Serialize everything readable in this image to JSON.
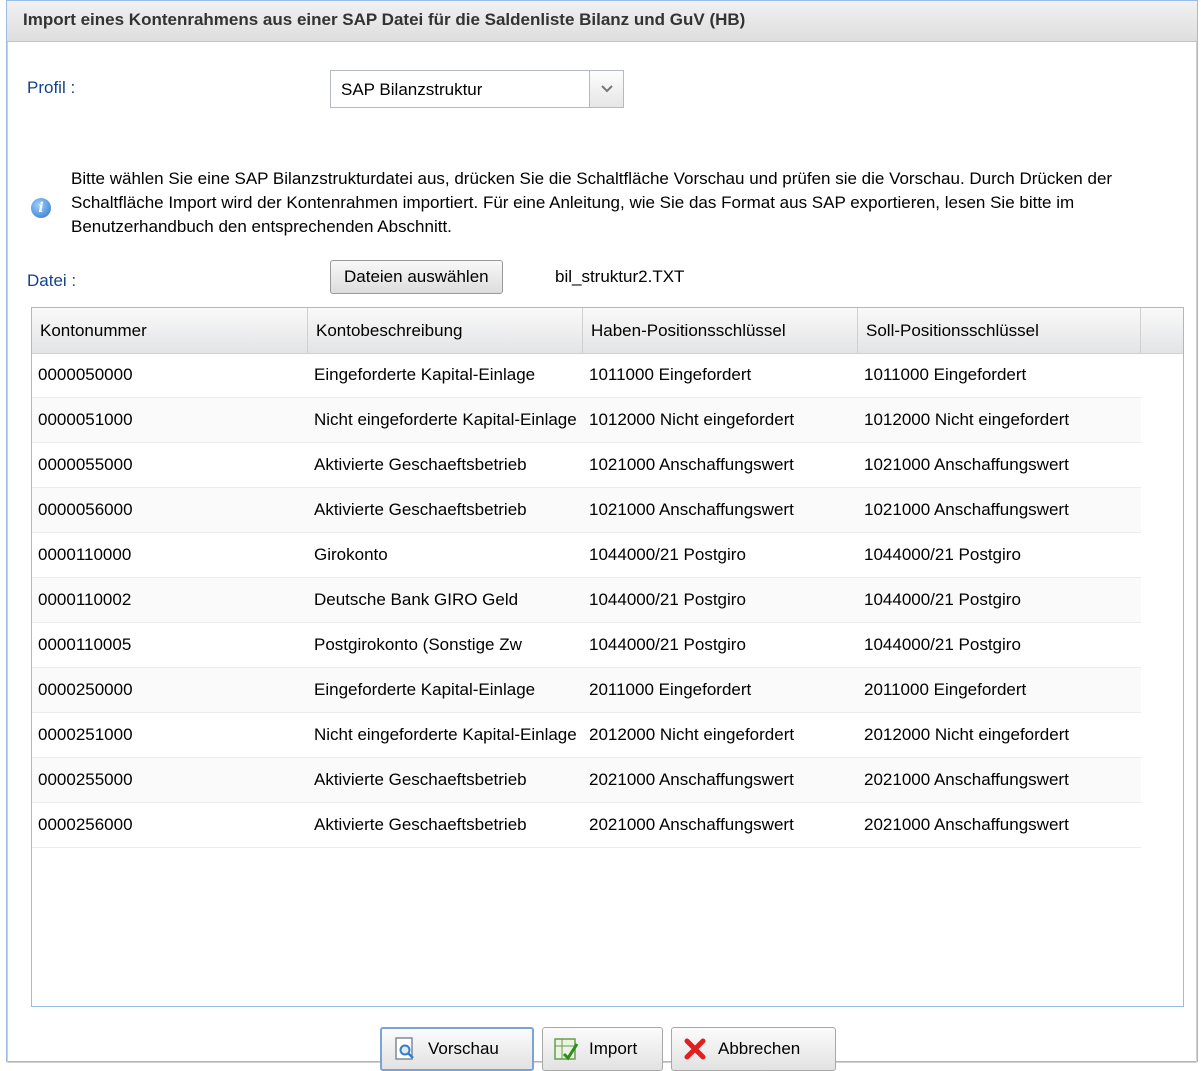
{
  "dialog": {
    "title": "Import eines Kontenrahmens aus einer SAP Datei für die Saldenliste Bilanz und GuV (HB)"
  },
  "form": {
    "profile_label": "Profil :",
    "profile_value": "SAP Bilanzstruktur",
    "info_text": "Bitte wählen Sie eine SAP Bilanzstrukturdatei aus, drücken Sie die Schaltfläche Vorschau und prüfen sie die Vorschau. Durch Drücken der Schaltfläche Import wird der Kontenrahmen importiert. Für eine Anleitung, wie Sie das Format aus SAP exportieren, lesen Sie bitte im Benutzerhandbuch den entsprechenden Abschnitt.",
    "file_label": "Datei :",
    "file_button": "Dateien auswählen",
    "file_name": "bil_struktur2.TXT"
  },
  "grid": {
    "columns": [
      "Kontonummer",
      "Kontobeschreibung",
      "Haben-Positionsschlüssel",
      "Soll-Positionsschlüssel"
    ],
    "rows": [
      [
        "0000050000",
        "Eingeforderte Kapital-Einlage",
        "1011000 Eingefordert",
        "1011000 Eingefordert"
      ],
      [
        "0000051000",
        "Nicht eingeforderte Kapital-Einlage",
        "1012000 Nicht eingefordert",
        "1012000 Nicht eingefordert"
      ],
      [
        "0000055000",
        "Aktivierte Geschaeftsbetrieb",
        "1021000 Anschaffungswert",
        "1021000 Anschaffungswert"
      ],
      [
        "0000056000",
        "Aktivierte Geschaeftsbetrieb",
        "1021000 Anschaffungswert",
        "1021000 Anschaffungswert"
      ],
      [
        "0000110000",
        "Girokonto",
        "1044000/21 Postgiro",
        "1044000/21 Postgiro"
      ],
      [
        "0000110002",
        "Deutsche Bank GIRO Geld",
        "1044000/21 Postgiro",
        "1044000/21 Postgiro"
      ],
      [
        "0000110005",
        "Postgirokonto (Sonstige Zw",
        "1044000/21 Postgiro",
        "1044000/21 Postgiro"
      ],
      [
        "0000250000",
        "Eingeforderte Kapital-Einlage",
        "2011000 Eingefordert",
        "2011000 Eingefordert"
      ],
      [
        "0000251000",
        "Nicht eingeforderte Kapital-Einlage",
        "2012000 Nicht eingefordert",
        "2012000 Nicht eingefordert"
      ],
      [
        "0000255000",
        "Aktivierte Geschaeftsbetrieb",
        "2021000 Anschaffungswert",
        "2021000 Anschaffungswert"
      ],
      [
        "0000256000",
        "Aktivierte Geschaeftsbetrieb",
        "2021000 Anschaffungswert",
        "2021000 Anschaffungswert"
      ]
    ]
  },
  "buttons": {
    "preview": "Vorschau",
    "import": "Import",
    "cancel": "Abbrechen"
  }
}
